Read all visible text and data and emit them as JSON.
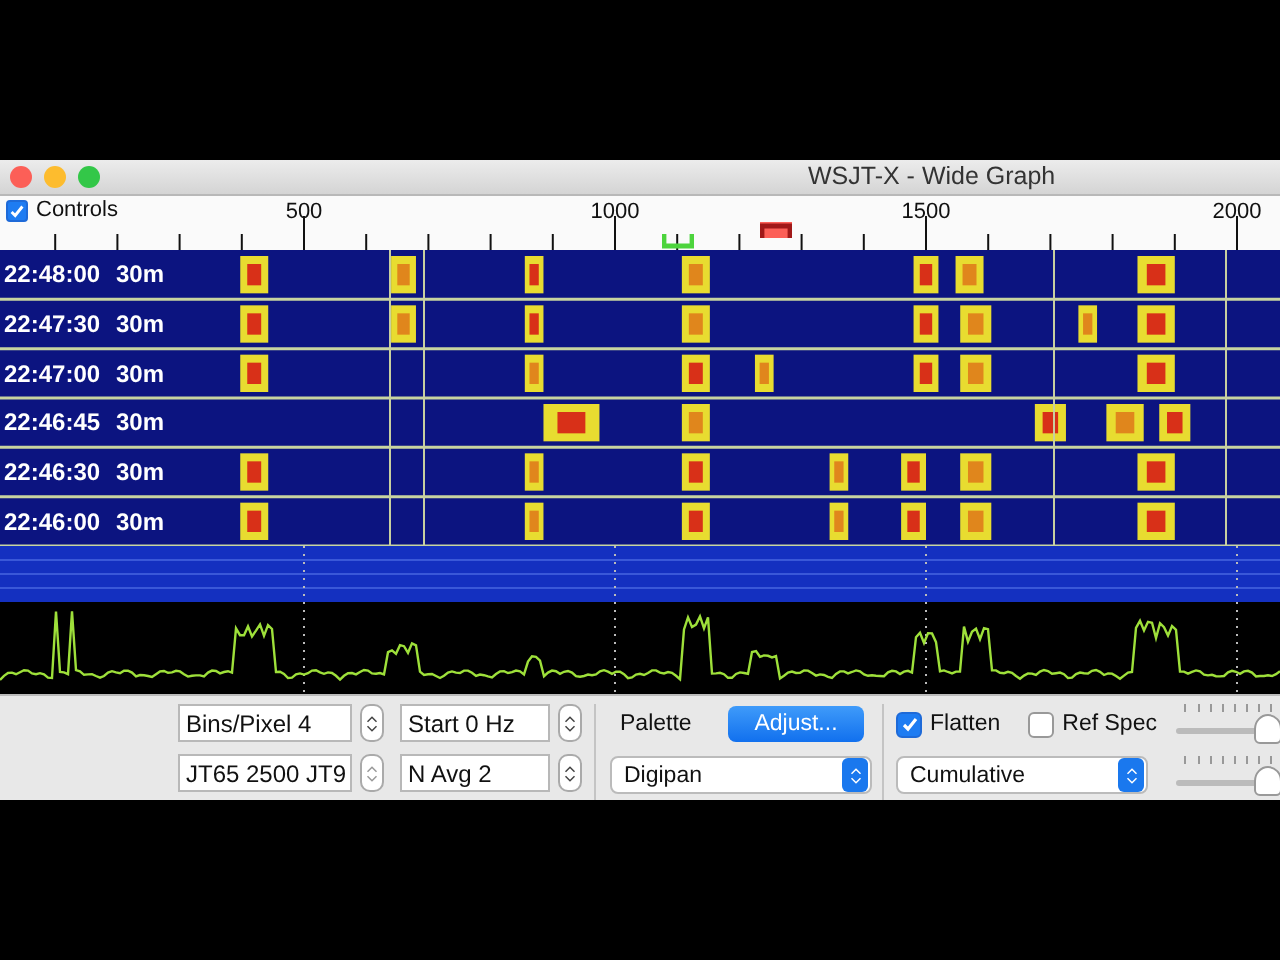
{
  "window": {
    "title": "WSJT-X - Wide Graph"
  },
  "controls_toggle": {
    "label": "Controls",
    "checked": true
  },
  "frequency_scale": {
    "labels": [
      "500",
      "1000",
      "1500",
      "2000"
    ]
  },
  "waterfall": {
    "rows": [
      {
        "time": "22:48:00",
        "band": "30m"
      },
      {
        "time": "22:47:30",
        "band": "30m"
      },
      {
        "time": "22:47:00",
        "band": "30m"
      },
      {
        "time": "22:46:45",
        "band": "30m"
      },
      {
        "time": "22:46:30",
        "band": "30m"
      },
      {
        "time": "22:46:00",
        "band": "30m"
      }
    ]
  },
  "settings": {
    "bins_pixel": "Bins/Pixel  4",
    "start": "Start 0 Hz",
    "modes": "JT65  2500  JT9",
    "n_avg": "N Avg 2",
    "palette_label": "Palette",
    "adjust_button": "Adjust...",
    "palette": "Digipan",
    "flatten": {
      "label": "Flatten",
      "checked": true
    },
    "ref_spec": {
      "label": "Ref Spec",
      "checked": false
    },
    "spectrum": "Cumulative",
    "sliders": [
      {
        "level": 0.78
      },
      {
        "level": 0.78
      }
    ]
  }
}
